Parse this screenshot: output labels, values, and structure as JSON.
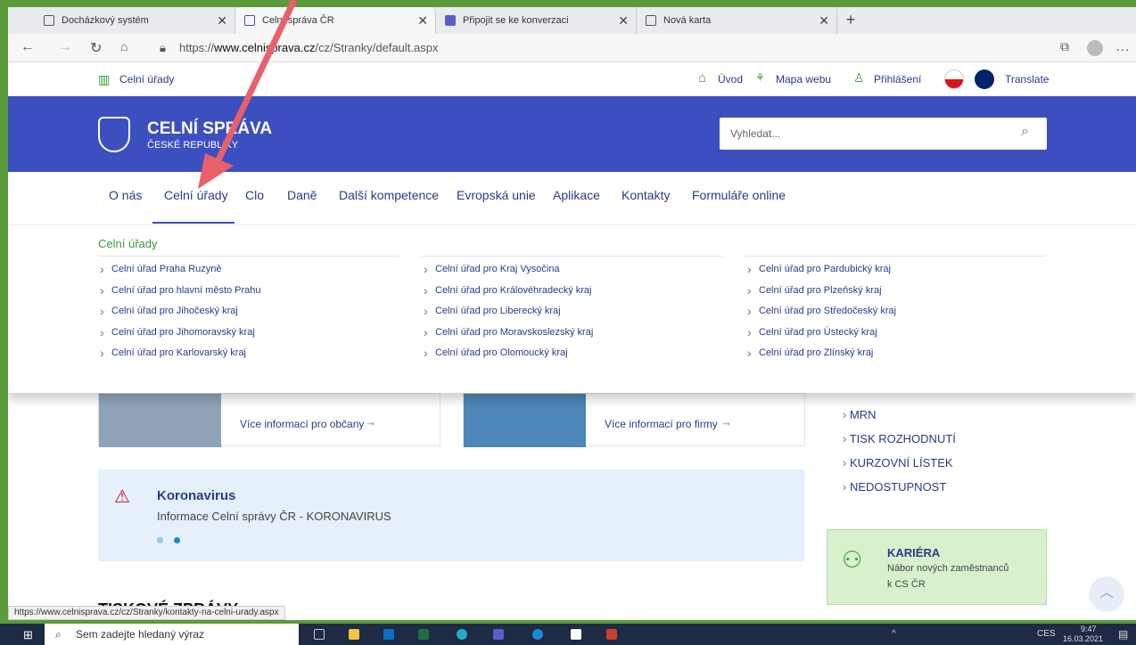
{
  "browser": {
    "tabs": [
      {
        "label": "Docházkový systém"
      },
      {
        "label": "Celní správa ČR"
      },
      {
        "label": "Připojit se ke konverzaci"
      },
      {
        "label": "Nová karta"
      }
    ],
    "url_prefix": "https://",
    "url_domain": "www.celnisprava.cz",
    "url_path": "/cz/Stranky/default.aspx",
    "status_url": "https://www.celnisprava.cz/cz/Stranky/kontakty-na-celni-urady.aspx"
  },
  "utility": {
    "left_link": "Celní úřady",
    "home": "Úvod",
    "sitemap": "Mapa webu",
    "login": "Přihlášení",
    "translate": "Translate"
  },
  "header": {
    "title": "CELNÍ SPRÁVA",
    "subtitle": "ČESKÉ REPUBLIKY",
    "search_placeholder": "Vyhledat..."
  },
  "nav": {
    "items": [
      "O nás",
      "Celní úřady",
      "Clo",
      "Daně",
      "Další kompetence",
      "Evropská unie",
      "Aplikace",
      "Kontakty",
      "Formuláře online"
    ]
  },
  "mega": {
    "heading": "Celní úřady",
    "col1": [
      "Celní úřad Praha Ruzyně",
      "Celní úřad pro hlavní město Prahu",
      "Celní úřad pro Jihočeský kraj",
      "Celní úřad pro Jihomoravský kraj",
      "Celní úřad pro Karlovarský kraj"
    ],
    "col2": [
      "Celní úřad pro Kraj Vysočina",
      "Celní úřad pro Královéhradecký kraj",
      "Celní úřad pro Liberecký kraj",
      "Celní úřad pro Moravskoslezský kraj",
      "Celní úřad pro Olomoucký kraj"
    ],
    "col3": [
      "Celní úřad pro Pardubický kraj",
      "Celní úřad pro Plzeňský kraj",
      "Celní úřad pro Středočeský kraj",
      "Celní úřad pro Ústecký kraj",
      "Celní úřad pro Zlínský kraj"
    ]
  },
  "cards": {
    "citizens": "Více informací pro občany",
    "firms": "Více informací pro firmy"
  },
  "side_links": [
    "MRN",
    "TISK ROZHODNUTÍ",
    "KURZOVNÍ LÍSTEK",
    "NEDOSTUPNOST"
  ],
  "notice": {
    "title": "Koronavirus",
    "text": "Informace Celní správy ČR - KORONAVIRUS"
  },
  "career": {
    "title": "KARIÉRA",
    "text1": "Nábor nových zaměstnanců",
    "text2": "k CS ČR"
  },
  "press_heading": "TISKOVÉ ZPRÁVY",
  "taskbar": {
    "search": "Sem zadejte hledaný výraz",
    "lang": "CES",
    "time": "9:47",
    "date": "16.03.2021"
  }
}
